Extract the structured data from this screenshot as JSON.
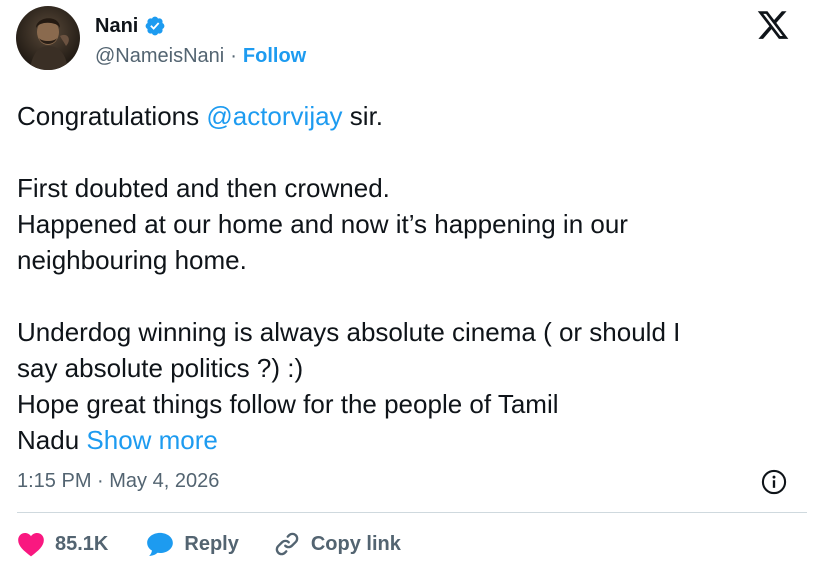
{
  "author": {
    "name": "Nani",
    "handle": "@NameisNani",
    "separator": "·",
    "follow_label": "Follow",
    "verified_icon": "verified-badge-icon"
  },
  "tweet": {
    "line1_prefix": "Congratulations ",
    "mention": "@actorvijay",
    "line1_suffix": " sir.",
    "para2_line1": "First doubted and then crowned.",
    "para2_line2": "Happened at our home and now it’s happening in our",
    "para2_line3": "neighbouring home.",
    "para3_line1": "Underdog winning is always absolute cinema ( or should I",
    "para3_line2": "say absolute politics ?) :)",
    "para3_line3": "Hope great things follow for the people of Tamil",
    "para3_line4_prefix": "Nadu ",
    "show_more": "Show more"
  },
  "timestamp": "1:15 PM · May 4, 2026",
  "actions": {
    "like_count": "85.1K",
    "reply_label": "Reply",
    "copy_link_label": "Copy link"
  },
  "colors": {
    "accent": "#1d9bf0",
    "like": "#f91880",
    "text": "#0f1419",
    "secondary": "#536471"
  }
}
